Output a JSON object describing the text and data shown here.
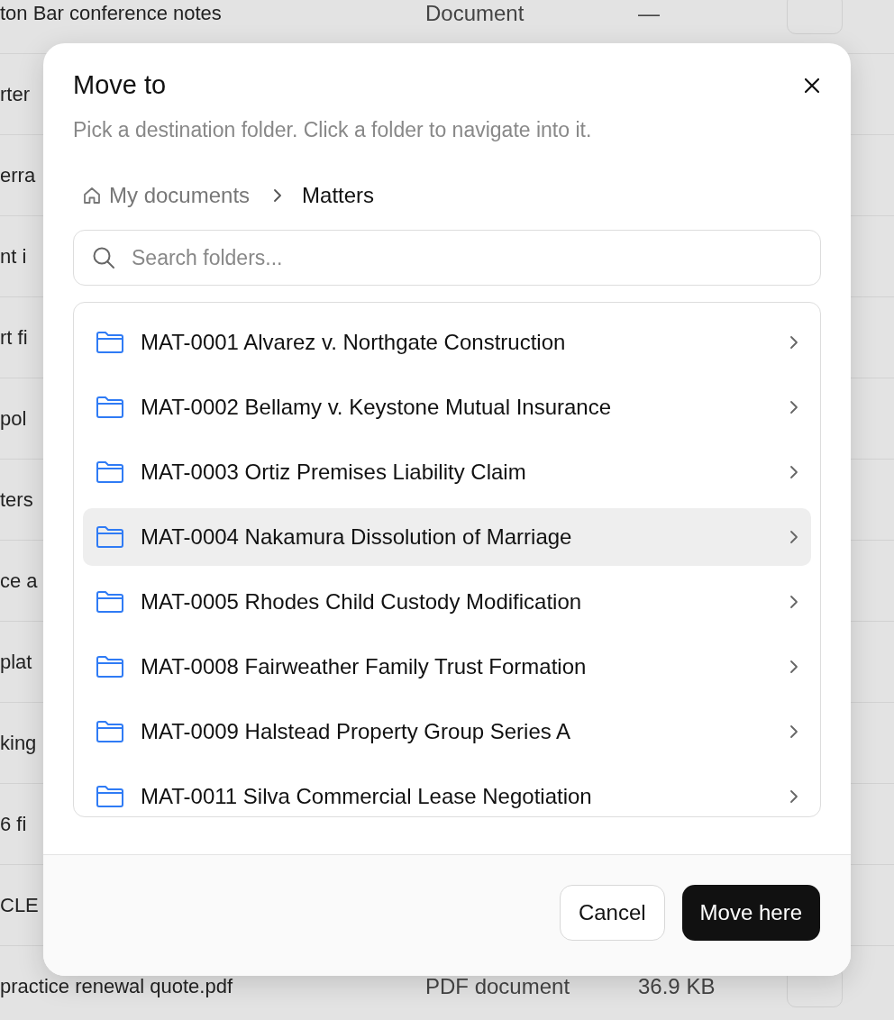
{
  "background_table": {
    "rows": [
      {
        "name": "ton Bar conference notes",
        "type": "Document",
        "size": "—"
      },
      {
        "name": "rter"
      },
      {
        "name": "erra"
      },
      {
        "name": "nt i"
      },
      {
        "name": "rt fi"
      },
      {
        "name": "pol"
      },
      {
        "name": "ters"
      },
      {
        "name": "ce a"
      },
      {
        "name": "plat"
      },
      {
        "name": "king"
      },
      {
        "name": "6 fi"
      },
      {
        "name": "CLE"
      },
      {
        "name": "practice renewal quote.pdf",
        "type": "PDF document",
        "size": "36.9 KB"
      }
    ]
  },
  "dialog": {
    "title": "Move to",
    "subtitle": "Pick a destination folder. Click a folder to navigate into it.",
    "breadcrumb": [
      {
        "label": "My documents",
        "current": false
      },
      {
        "label": "Matters",
        "current": true
      }
    ],
    "search": {
      "placeholder": "Search folders..."
    },
    "folders": [
      {
        "name": "MAT-0001 Alvarez v. Northgate Construction",
        "highlighted": false
      },
      {
        "name": "MAT-0002 Bellamy v. Keystone Mutual Insurance",
        "highlighted": false
      },
      {
        "name": "MAT-0003 Ortiz Premises Liability Claim",
        "highlighted": false
      },
      {
        "name": "MAT-0004 Nakamura Dissolution of Marriage",
        "highlighted": true
      },
      {
        "name": "MAT-0005 Rhodes Child Custody Modification",
        "highlighted": false
      },
      {
        "name": "MAT-0008 Fairweather Family Trust Formation",
        "highlighted": false
      },
      {
        "name": "MAT-0009 Halstead Property Group Series A",
        "highlighted": false
      },
      {
        "name": "MAT-0011 Silva Commercial Lease Negotiation",
        "highlighted": false
      }
    ],
    "buttons": {
      "cancel": "Cancel",
      "confirm": "Move here"
    }
  }
}
